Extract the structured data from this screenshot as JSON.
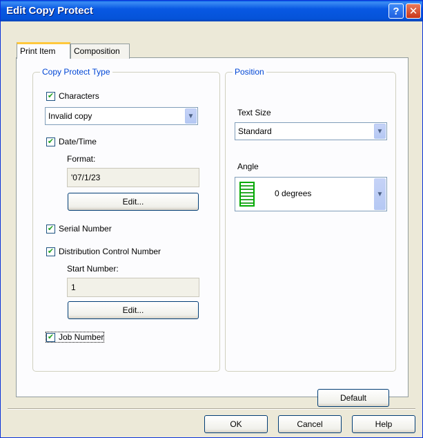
{
  "window": {
    "title": "Edit Copy Protect"
  },
  "tabs": [
    {
      "label": "Print Item",
      "active": true
    },
    {
      "label": "Composition",
      "active": false
    }
  ],
  "copy_protect": {
    "legend": "Copy Protect Type",
    "characters": {
      "label": "Characters",
      "checked": true
    },
    "characters_value": "Invalid copy",
    "datetime": {
      "label": "Date/Time",
      "checked": true
    },
    "format_label": "Format:",
    "format_value": "'07/1/23",
    "edit_label_1": "Edit...",
    "serial": {
      "label": "Serial Number",
      "checked": true
    },
    "distribution": {
      "label": "Distribution Control Number",
      "checked": true
    },
    "start_label": "Start Number:",
    "start_value": "1",
    "edit_label_2": "Edit...",
    "job": {
      "label": "Job Number",
      "checked": true
    }
  },
  "position": {
    "legend": "Position",
    "text_size_label": "Text Size",
    "text_size_value": "Standard",
    "angle_label": "Angle",
    "angle_value": "0 degrees"
  },
  "buttons": {
    "default": "Default",
    "ok": "OK",
    "cancel": "Cancel",
    "help": "Help"
  }
}
